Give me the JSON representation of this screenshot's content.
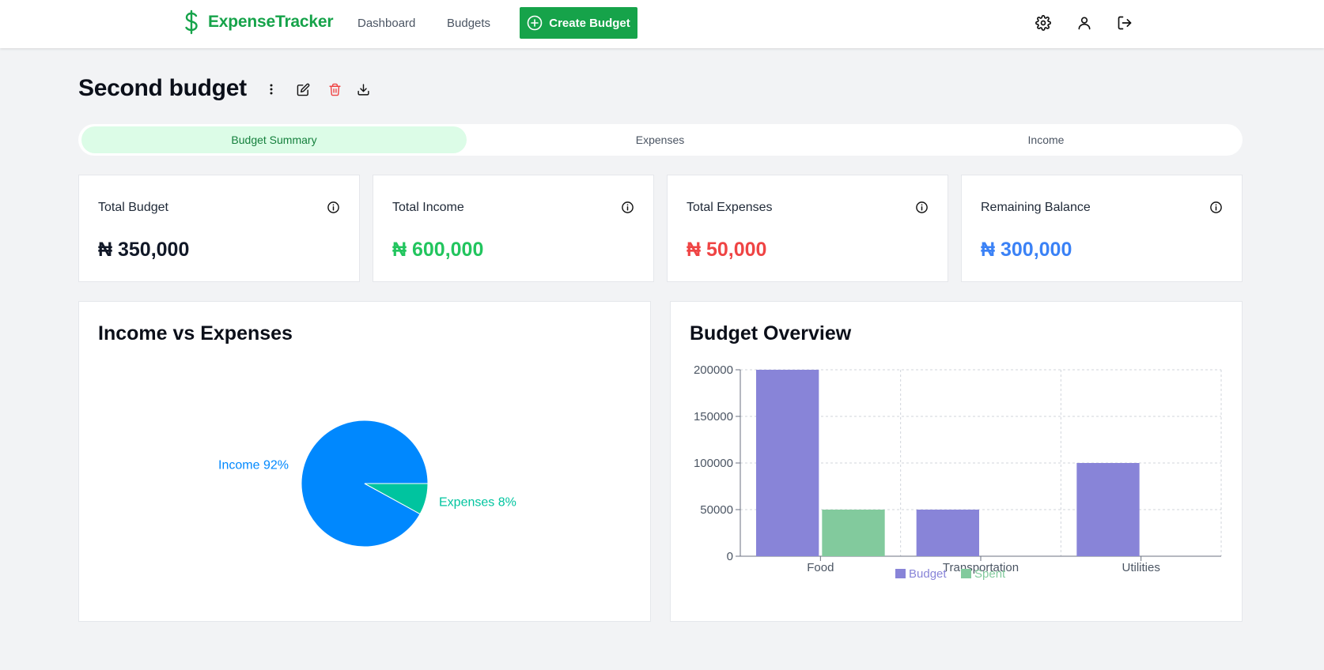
{
  "header": {
    "brand": "ExpenseTracker",
    "nav": [
      "Dashboard",
      "Budgets"
    ],
    "create_label": "Create Budget",
    "icons": [
      "gear-icon",
      "user-icon",
      "logout-icon"
    ],
    "accent": "#16a34a"
  },
  "page": {
    "title": "Second budget",
    "actions": [
      "more-vertical-icon",
      "edit-icon",
      "trash-icon",
      "download-icon"
    ]
  },
  "tabs": [
    "Budget Summary",
    "Expenses",
    "Income"
  ],
  "active_tab": "Budget Summary",
  "stats": [
    {
      "label": "Total Budget",
      "value": "₦ 350,000",
      "color": "#111827"
    },
    {
      "label": "Total Income",
      "value": "₦ 600,000",
      "color": "#22c55e"
    },
    {
      "label": "Total Expenses",
      "value": "₦ 50,000",
      "color": "#ef4444"
    },
    {
      "label": "Remaining Balance",
      "value": "₦ 300,000",
      "color": "#3b82f6"
    }
  ],
  "charts": {
    "pie_title": "Income vs Expenses",
    "bar_title": "Budget Overview"
  },
  "chart_data": [
    {
      "type": "pie",
      "title": "Income vs Expenses",
      "slices": [
        {
          "label": "Income 92%",
          "value": 92,
          "color": "#0088fe"
        },
        {
          "label": "Expenses 8%",
          "value": 8,
          "color": "#00c49f"
        }
      ]
    },
    {
      "type": "bar",
      "title": "Budget Overview",
      "categories": [
        "Food",
        "Transportation",
        "Utilities"
      ],
      "series": [
        {
          "name": "Budget",
          "values": [
            200000,
            50000,
            100000
          ],
          "color": "#8884d8"
        },
        {
          "name": "Spent",
          "values": [
            50000,
            0,
            0
          ],
          "color": "#82ca9d"
        }
      ],
      "yticks": [
        0,
        50000,
        100000,
        150000,
        200000
      ],
      "ylim": [
        0,
        200000
      ],
      "grid": true,
      "legend": "bottom"
    }
  ]
}
